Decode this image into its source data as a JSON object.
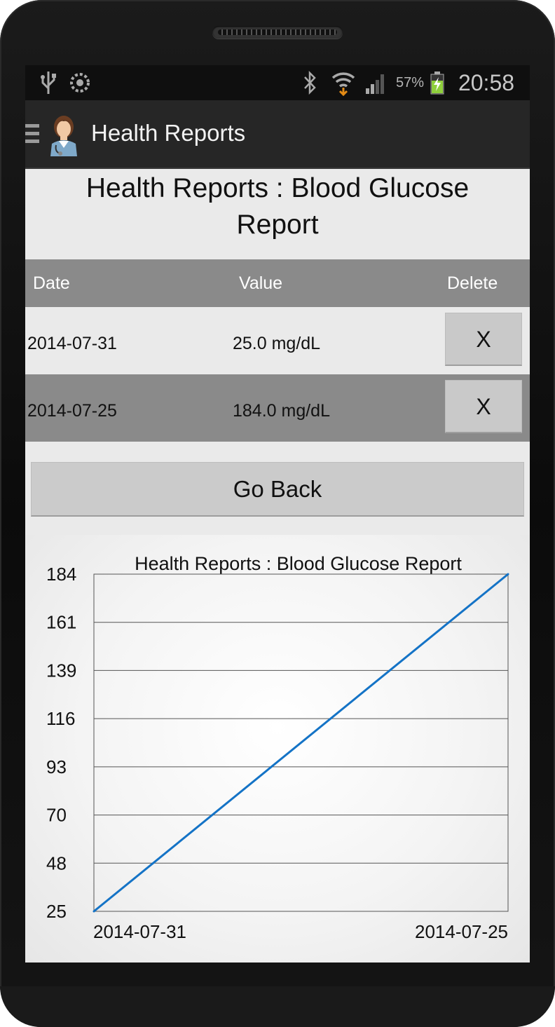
{
  "statusbar": {
    "battery": "57%",
    "time": "20:58",
    "icons": [
      "usb-icon",
      "sync-icon",
      "bluetooth-icon",
      "wifi-icon",
      "signal-icon",
      "battery-charging-icon"
    ]
  },
  "actionbar": {
    "title": "Health Reports"
  },
  "page": {
    "title_line1": "Health Reports : Blood Glucose",
    "title_line2": "Report"
  },
  "table": {
    "headers": {
      "date": "Date",
      "value": "Value",
      "delete": "Delete"
    },
    "rows": [
      {
        "date": "2014-07-31",
        "value": "25.0 mg/dL",
        "delete": "X"
      },
      {
        "date": "2014-07-25",
        "value": "184.0 mg/dL",
        "delete": "X"
      }
    ]
  },
  "buttons": {
    "go_back": "Go Back"
  },
  "chart_data": {
    "type": "line",
    "title": "Health Reports : Blood Glucose Report",
    "categories": [
      "2014-07-31",
      "2014-07-25"
    ],
    "series": [
      {
        "values": [
          25,
          184
        ],
        "color": "#1473c6"
      }
    ],
    "yticks": [
      "184",
      "161",
      "139",
      "116",
      "93",
      "70",
      "48",
      "25"
    ],
    "ylim": [
      25,
      184
    ],
    "grid": true
  }
}
